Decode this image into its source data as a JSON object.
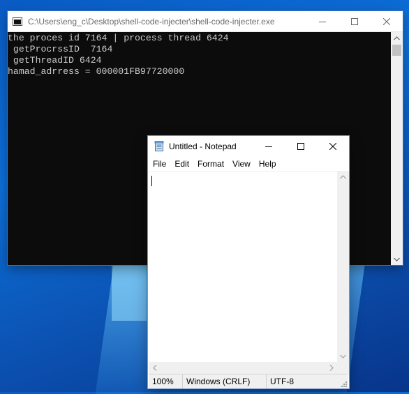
{
  "console": {
    "title": "C:\\Users\\eng_c\\Desktop\\shell-code-injecter\\shell-code-injecter.exe",
    "lines": [
      "the proces id 7164 | process thread 6424",
      " getProcrssID  7164",
      " getThreadID 6424",
      "hamad_adrress = 000001FB97720000"
    ]
  },
  "notepad": {
    "title": "Untitled - Notepad",
    "menu": [
      "File",
      "Edit",
      "Format",
      "View",
      "Help"
    ],
    "content": "",
    "status": {
      "zoom": "100%",
      "line_endings": "Windows (CRLF)",
      "encoding": "UTF-8"
    }
  },
  "icons": {
    "minimize": "minimize-icon",
    "maximize": "maximize-icon",
    "close": "close-icon",
    "console_app": "console-app-icon",
    "notepad_app": "notepad-app-icon"
  }
}
